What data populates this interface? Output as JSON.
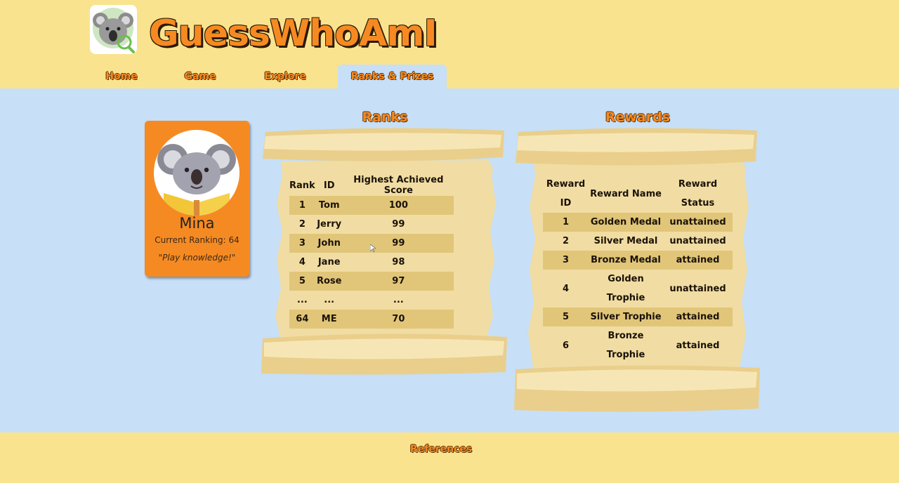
{
  "header": {
    "logo_icon": "koala-magnifier-icon",
    "site_title": "GuessWhoAmI",
    "nav": {
      "home": "Home",
      "game": "Game",
      "explore": "Explore",
      "ranks": "Ranks & Prizes"
    },
    "active_tab": "Ranks & Prizes"
  },
  "profile": {
    "avatar_icon": "koala-reading-icon",
    "name": "Mina",
    "ranking": "Current Ranking: 64",
    "quote": "\"Play knowledge!\""
  },
  "ranks": {
    "title": "Ranks",
    "headers": {
      "rank": "Rank",
      "id": "ID",
      "score": "Highest Achieved Score"
    },
    "rows": [
      {
        "rank": "1",
        "id": "Tom",
        "score": "100"
      },
      {
        "rank": "2",
        "id": "Jerry",
        "score": "99"
      },
      {
        "rank": "3",
        "id": "John",
        "score": "99"
      },
      {
        "rank": "4",
        "id": "Jane",
        "score": "98"
      },
      {
        "rank": "5",
        "id": "Rose",
        "score": "97"
      },
      {
        "rank": "...",
        "id": "...",
        "score": "..."
      },
      {
        "rank": "64",
        "id": "ME",
        "score": "70"
      }
    ]
  },
  "rewards": {
    "title": "Rewards",
    "headers": {
      "id_line1": "Reward",
      "id_line2": "ID",
      "name": "Reward Name",
      "status_line1": "Reward",
      "status_line2": "Status"
    },
    "rows": [
      {
        "id": "1",
        "name": "Golden Medal",
        "status": "unattained"
      },
      {
        "id": "2",
        "name": "Silver Medal",
        "status": "unattained"
      },
      {
        "id": "3",
        "name": "Bronze Medal",
        "status": "attained"
      },
      {
        "id": "4",
        "name_line1": "Golden",
        "name_line2": "Trophie",
        "status": "unattained"
      },
      {
        "id": "5",
        "name": "Silver Trophie",
        "status": "attained"
      },
      {
        "id": "6",
        "name_line1": "Bronze",
        "name_line2": "Trophie",
        "status": "attained"
      }
    ]
  },
  "footer": {
    "references": "References"
  },
  "colors": {
    "header_bg": "#fae38e",
    "page_bg": "#c7dff7",
    "accent": "#f68a22",
    "parchment": "#f1dda3"
  }
}
